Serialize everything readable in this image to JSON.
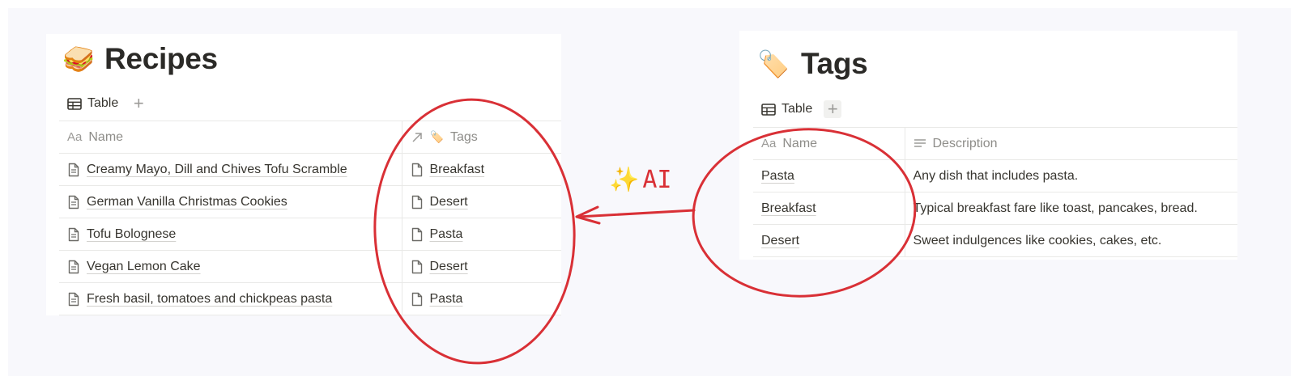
{
  "recipes": {
    "emoji": "🥪",
    "title": "Recipes",
    "view_tab_label": "Table",
    "add_view_symbol": "+",
    "columns": {
      "name": "Name",
      "name_icon": "Aa",
      "tags": "Tags"
    },
    "rows": [
      {
        "name": "Creamy Mayo, Dill and Chives Tofu Scramble",
        "tag": "Breakfast"
      },
      {
        "name": "German Vanilla Christmas Cookies",
        "tag": "Desert"
      },
      {
        "name": "Tofu Bolognese",
        "tag": "Pasta"
      },
      {
        "name": "Vegan Lemon Cake",
        "tag": "Desert"
      },
      {
        "name": "Fresh basil, tomatoes and chickpeas pasta",
        "tag": "Pasta"
      }
    ]
  },
  "tags": {
    "emoji": "🏷️",
    "title": "Tags",
    "view_tab_label": "Table",
    "add_view_symbol": "+",
    "columns": {
      "name": "Name",
      "name_icon": "Aa",
      "description": "Description"
    },
    "rows": [
      {
        "name": "Pasta",
        "description": "Any dish that includes pasta."
      },
      {
        "name": "Breakfast",
        "description": "Typical breakfast fare like toast, pancakes, bread."
      },
      {
        "name": "Desert",
        "description": "Sweet indulgences like cookies, cakes, etc."
      }
    ]
  },
  "annotation": {
    "sparkle_emoji": "✨",
    "label": "AI",
    "color": "#d93036"
  },
  "icons": {
    "table": "table-icon",
    "document": "document-icon",
    "relation": "relation-arrow-icon",
    "text_lines": "text-lines-icon"
  }
}
